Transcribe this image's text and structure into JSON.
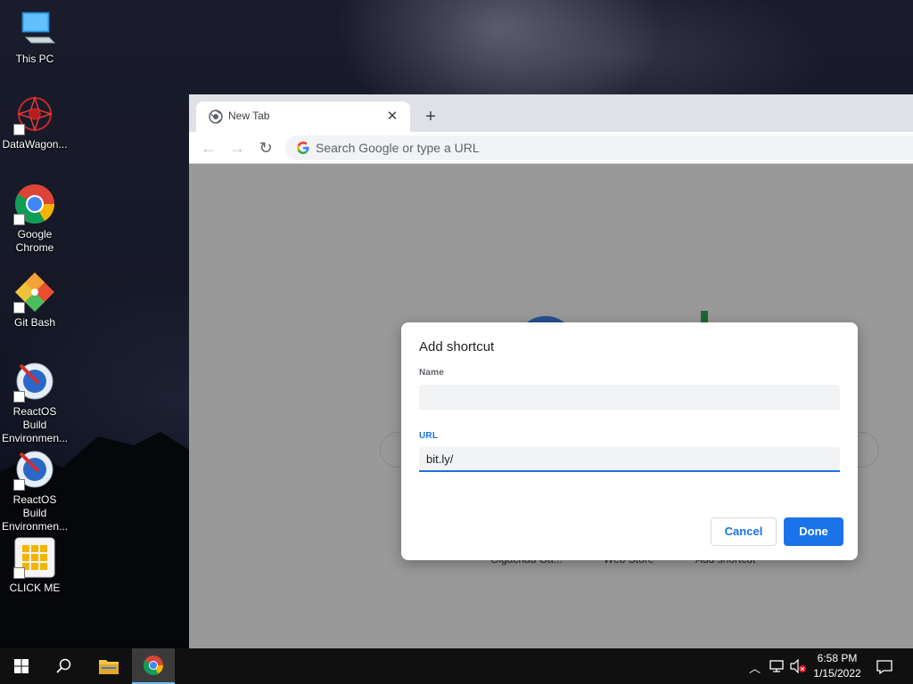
{
  "desktop": {
    "icons": [
      {
        "label": "This PC",
        "icon": "computer-icon"
      },
      {
        "label": "DataWagon...",
        "icon": "datawagon-icon"
      },
      {
        "label": "Google Chrome",
        "icon": "chrome-icon"
      },
      {
        "label": "Git Bash",
        "icon": "git-bash-icon"
      },
      {
        "label": "ReactOS Build Environmen...",
        "icon": "reactos-icon"
      },
      {
        "label": "ReactOS Build Environmen...",
        "icon": "reactos-icon"
      },
      {
        "label": "CLICK ME",
        "icon": "click-me-icon"
      }
    ]
  },
  "browser": {
    "tab": {
      "title": "New Tab",
      "close_glyph": "✕"
    },
    "new_tab_glyph": "+",
    "omnibox": {
      "placeholder": "Search Google or type a URL"
    },
    "nav": {
      "back": "←",
      "forward": "→",
      "reload": "↻"
    },
    "shortcut_tiles": [
      "Gigachad Ga...",
      "Web Store",
      "Add shortcut"
    ]
  },
  "dialog": {
    "title": "Add shortcut",
    "name_label": "Name",
    "name_value": "",
    "url_label": "URL",
    "url_value": "bit.ly/",
    "cancel_label": "Cancel",
    "done_label": "Done"
  },
  "taskbar": {
    "clock_time": "6:58 PM",
    "clock_date": "1/15/2022"
  },
  "colors": {
    "accent": "#1a73e8",
    "taskbar": "#101010"
  }
}
